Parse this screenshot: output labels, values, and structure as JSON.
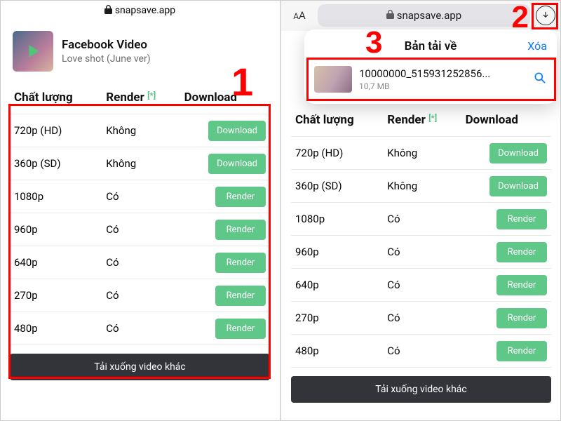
{
  "site": {
    "domain": "snapsave.app"
  },
  "video": {
    "title": "Facebook Video",
    "subtitle": "Love shot (June ver)"
  },
  "table": {
    "headers": {
      "quality": "Chất lượng",
      "render": "Render",
      "render_sup": "[*]",
      "download": "Download"
    },
    "rows": [
      {
        "quality": "720p (HD)",
        "render": "Không",
        "action": "Download"
      },
      {
        "quality": "360p (SD)",
        "render": "Không",
        "action": "Download"
      },
      {
        "quality": "1080p",
        "render": "Có",
        "action": "Render"
      },
      {
        "quality": "960p",
        "render": "Có",
        "action": "Render"
      },
      {
        "quality": "640p",
        "render": "Có",
        "action": "Render"
      },
      {
        "quality": "270p",
        "render": "Có",
        "action": "Render"
      },
      {
        "quality": "480p",
        "render": "Có",
        "action": "Render"
      }
    ]
  },
  "bottom_button": "Tải xuống video khác",
  "browser_right": {
    "aa": "AA"
  },
  "downloads": {
    "title": "Bản tải về",
    "clear": "Xóa",
    "item": {
      "name": "10000000_515931252856...",
      "size": "10,7 MB"
    }
  },
  "annotations": {
    "n1": "1",
    "n2": "2",
    "n3": "3"
  }
}
